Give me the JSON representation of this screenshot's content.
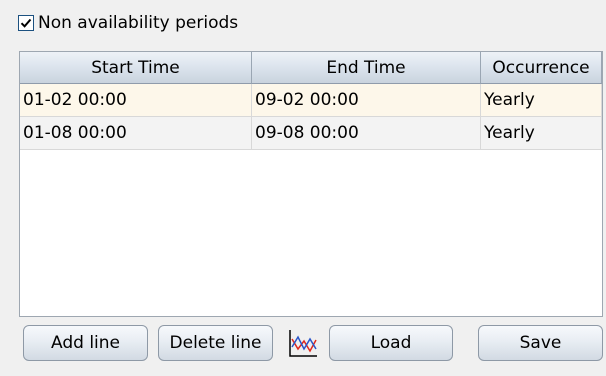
{
  "checkbox": {
    "label": "Non availability periods",
    "checked": true
  },
  "table": {
    "columns": [
      "Start Time",
      "End Time",
      "Occurrence"
    ],
    "rows": [
      [
        "01-02 00:00",
        "09-02 00:00",
        "Yearly"
      ],
      [
        "01-08 00:00",
        "09-08 00:00",
        "Yearly"
      ]
    ]
  },
  "buttons": {
    "add": "Add line",
    "delete": "Delete line",
    "chart_icon": "chart-icon",
    "load": "Load",
    "save": "Save"
  },
  "colors": {
    "selected_row": "#fdf7ea",
    "header_gradient_bottom": "#c9d3de",
    "chart_red": "#e0281e",
    "chart_blue": "#2a55c8"
  }
}
